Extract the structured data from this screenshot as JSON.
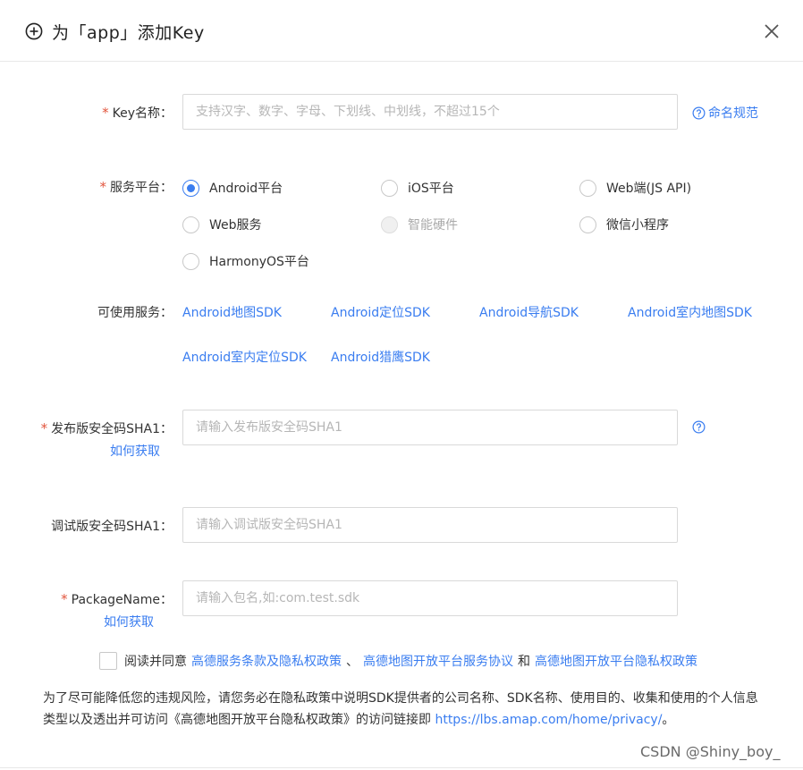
{
  "dialog": {
    "title": "为「app」添加Key",
    "icon": "plus-circle-icon",
    "close_icon": "close-icon"
  },
  "key_name": {
    "required_mark": "*",
    "label": "Key名称：",
    "placeholder": "支持汉字、数字、字母、下划线、中划线，不超过15个",
    "value": "",
    "help_label": "命名规范"
  },
  "platform": {
    "required_mark": "*",
    "label": "服务平台：",
    "options": [
      {
        "label": "Android平台",
        "checked": true,
        "disabled": false
      },
      {
        "label": "iOS平台",
        "checked": false,
        "disabled": false
      },
      {
        "label": "Web端(JS API)",
        "checked": false,
        "disabled": false
      },
      {
        "label": "Web服务",
        "checked": false,
        "disabled": false
      },
      {
        "label": "智能硬件",
        "checked": false,
        "disabled": true
      },
      {
        "label": "微信小程序",
        "checked": false,
        "disabled": false
      },
      {
        "label": "HarmonyOS平台",
        "checked": false,
        "disabled": false
      }
    ]
  },
  "services": {
    "label": "可使用服务：",
    "items": [
      "Android地图SDK",
      "Android定位SDK",
      "Android导航SDK",
      "Android室内地图SDK",
      "Android室内定位SDK",
      "Android猎鹰SDK"
    ]
  },
  "release_sha1": {
    "required_mark": "*",
    "label": "发布版安全码SHA1：",
    "placeholder": "请输入发布版安全码SHA1",
    "value": "",
    "how_to_get": "如何获取"
  },
  "debug_sha1": {
    "label": "调试版安全码SHA1：",
    "placeholder": "请输入调试版安全码SHA1",
    "value": ""
  },
  "package_name": {
    "required_mark": "*",
    "label": "PackageName：",
    "placeholder": "请输入包名,如:com.test.sdk",
    "value": "",
    "how_to_get": "如何获取"
  },
  "agreement": {
    "checked": false,
    "prefix": "阅读并同意",
    "link1": "高德服务条款及隐私权政策",
    "separator": "、",
    "link2": "高德地图开放平台服务协议",
    "conjunction": "和",
    "link3": "高德地图开放平台隐私权政策"
  },
  "notice": {
    "text": "为了尽可能降低您的违规风险，请您务必在隐私政策中说明SDK提供者的公司名称、SDK名称、使用目的、收集和使用的个人信息类型以及透出并可访问《高德地图开放平台隐私权政策》的访问链接即",
    "link": "https://lbs.amap.com/home/privacy/",
    "suffix": "。"
  },
  "watermark": "CSDN @Shiny_boy_",
  "colors": {
    "accent": "#3a7df0",
    "required": "#e2553d",
    "border": "#d9d9d9"
  }
}
